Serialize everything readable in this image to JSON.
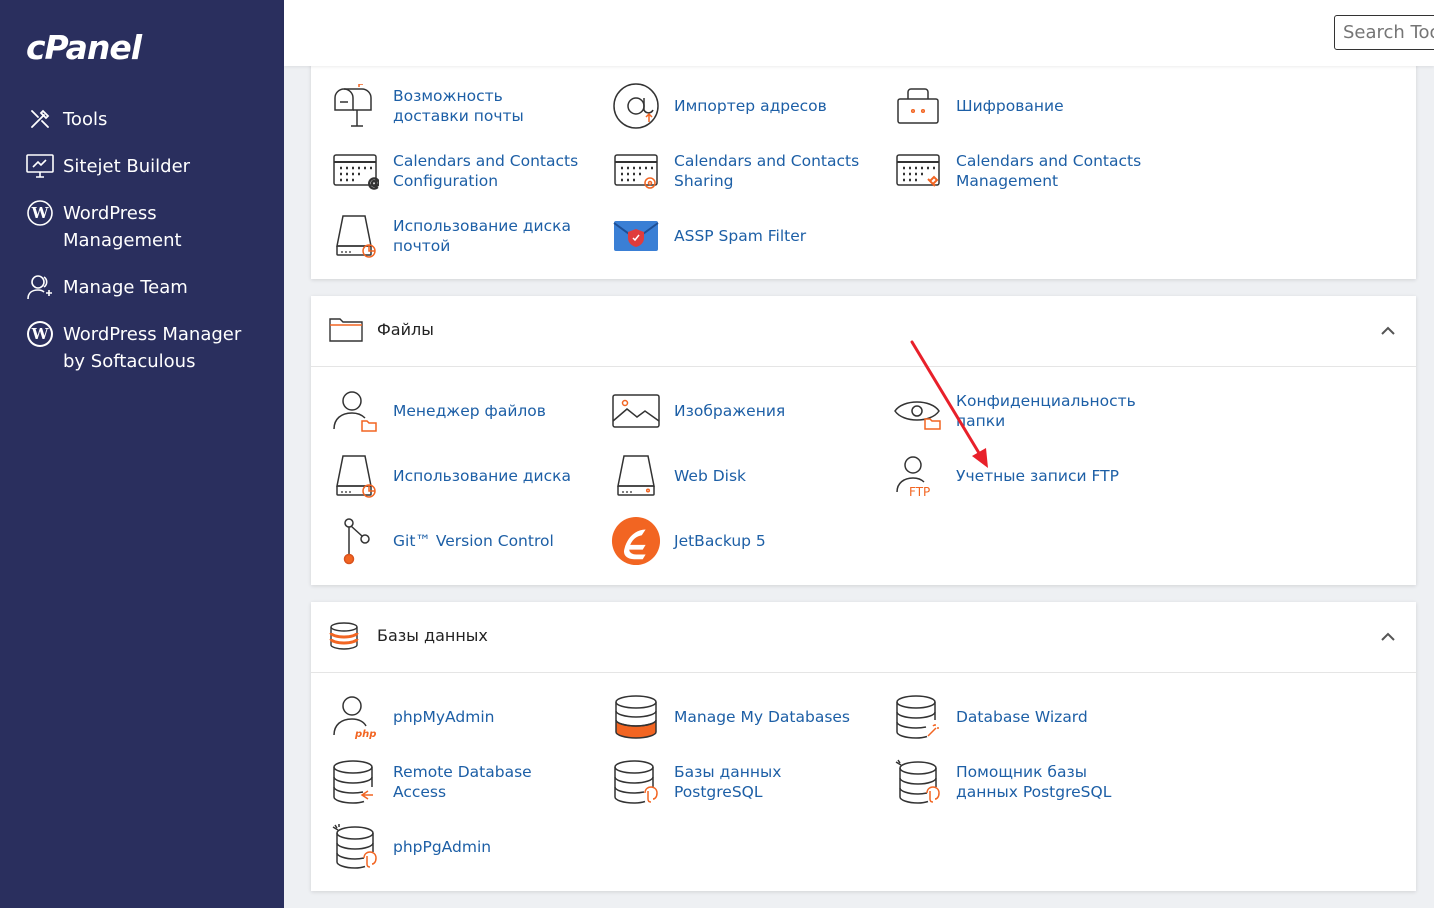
{
  "brand": {
    "logo_text": "cPanel"
  },
  "sidebar": {
    "items": [
      {
        "label": "Tools",
        "icon": "tools-icon"
      },
      {
        "label": "Sitejet Builder",
        "icon": "sitejet-icon"
      },
      {
        "label": "WordPress Management",
        "icon": "wordpress-icon"
      },
      {
        "label": "Manage Team",
        "icon": "team-icon"
      },
      {
        "label": "WordPress Manager by Softaculous",
        "icon": "wordpress-icon"
      }
    ]
  },
  "header": {
    "search_placeholder": "Search Tools"
  },
  "email_panel": {
    "items": [
      {
        "label": "Возможность доставки почты",
        "icon": "mailbox-icon"
      },
      {
        "label": "Импортер адресов",
        "icon": "at-import-icon"
      },
      {
        "label": "Шифрование",
        "icon": "encryption-icon"
      },
      {
        "label": "Calendars and Contacts Configuration",
        "icon": "calendar-config-icon"
      },
      {
        "label": "Calendars and Contacts Sharing",
        "icon": "calendar-sharing-icon"
      },
      {
        "label": "Calendars and Contacts Management",
        "icon": "calendar-management-icon"
      },
      {
        "label": "Использование диска почтой",
        "icon": "mail-disk-icon"
      },
      {
        "label": "ASSP Spam Filter",
        "icon": "spam-filter-icon"
      }
    ]
  },
  "files_panel": {
    "title": "Файлы",
    "icon": "folder-icon",
    "items": [
      {
        "label": "Менеджер файлов",
        "icon": "file-manager-icon"
      },
      {
        "label": "Изображения",
        "icon": "images-icon"
      },
      {
        "label": "Конфиденциальность папки",
        "icon": "directory-privacy-icon"
      },
      {
        "label": "Использование диска",
        "icon": "disk-usage-icon"
      },
      {
        "label": "Web Disk",
        "icon": "web-disk-icon"
      },
      {
        "label": "Учетные записи FTP",
        "icon": "ftp-accounts-icon"
      },
      {
        "label": "Git™ Version Control",
        "icon": "git-icon"
      },
      {
        "label": "JetBackup 5",
        "icon": "jetbackup-icon"
      }
    ]
  },
  "db_panel": {
    "title": "Базы данных",
    "icon": "database-icon",
    "items": [
      {
        "label": "phpMyAdmin",
        "icon": "phpmyadmin-icon"
      },
      {
        "label": "Manage My Databases",
        "icon": "manage-databases-icon"
      },
      {
        "label": "Database Wizard",
        "icon": "database-wizard-icon"
      },
      {
        "label": "Remote Database Access",
        "icon": "remote-database-icon"
      },
      {
        "label": "Базы данных PostgreSQL",
        "icon": "postgresql-icon"
      },
      {
        "label": "Помощник базы данных PostgreSQL",
        "icon": "postgresql-wizard-icon"
      },
      {
        "label": "phpPgAdmin",
        "icon": "phppgadmin-icon"
      }
    ]
  },
  "colors": {
    "sidebar_bg": "#2a2f5e",
    "link": "#1d5fa6",
    "accent": "#f26522",
    "annotation_arrow": "#e8202a"
  }
}
